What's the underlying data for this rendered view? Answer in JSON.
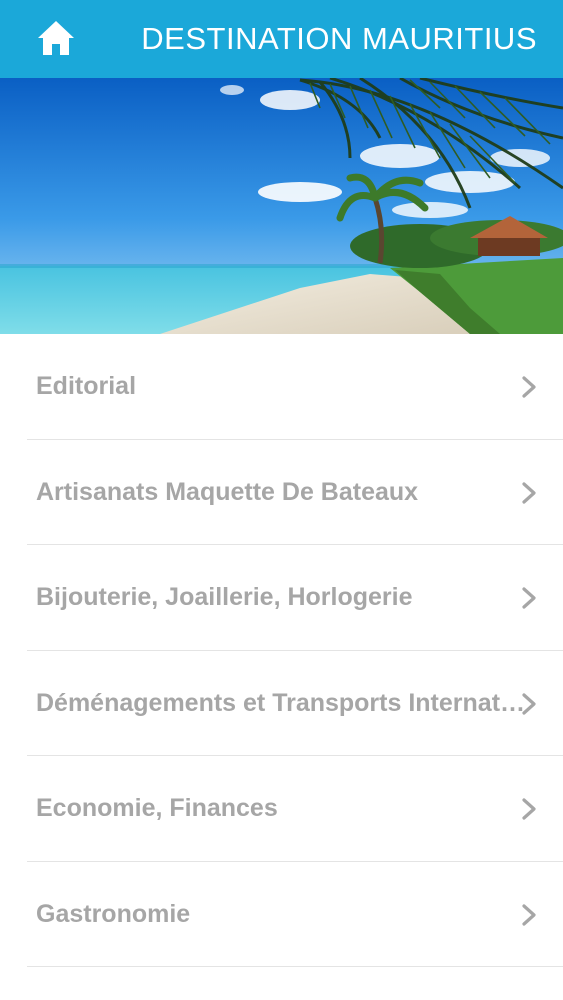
{
  "header": {
    "title": "DESTINATION MAURITIUS",
    "home_icon": "home-icon",
    "background_color": "#1ba8d9"
  },
  "hero": {
    "image_description_icon": "beach-palm-photo"
  },
  "menu": {
    "items": [
      {
        "label": "Editorial",
        "icon": "chevron-right-icon"
      },
      {
        "label": "Artisanats Maquette De Bateaux",
        "icon": "chevron-right-icon"
      },
      {
        "label": "Bijouterie, Joaillerie, Horlogerie",
        "icon": "chevron-right-icon"
      },
      {
        "label": "Déménagements et Transports Internationaux",
        "icon": "chevron-right-icon"
      },
      {
        "label": "Economie, Finances",
        "icon": "chevron-right-icon"
      },
      {
        "label": "Gastronomie",
        "icon": "chevron-right-icon"
      }
    ],
    "text_color": "#a6a6a6"
  }
}
